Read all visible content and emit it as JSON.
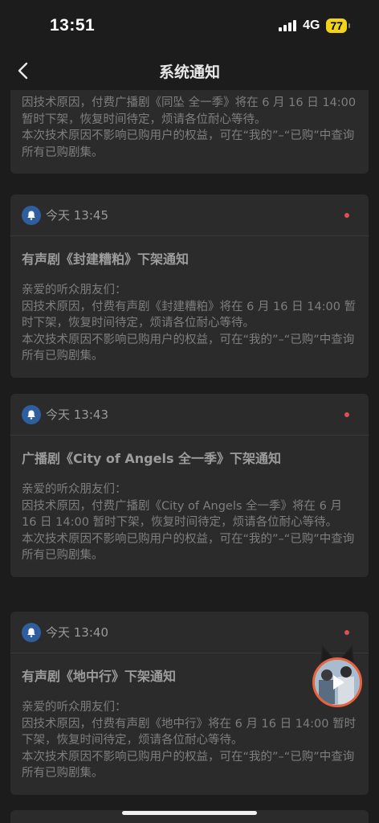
{
  "status": {
    "time": "13:51",
    "network": "4G",
    "battery": "77"
  },
  "nav": {
    "title": "系统通知"
  },
  "cards": [
    {
      "time": "",
      "title": "",
      "lines": [
        "因技术原因，付费广播剧《同坠 全一季》将在 6 月 16 日 14:00 暂时下架，恢复时间待定，烦请各位耐心等待。",
        "本次技术原因不影响已购用户的权益，可在“我的”–“已购”中查询所有已购剧集。"
      ]
    },
    {
      "time": "今天 13:45",
      "title": "有声剧《封建糟粕》下架通知",
      "lines": [
        "亲爱的听众朋友们：",
        "因技术原因，付费有声剧《封建糟粕》将在 6 月 16 日 14:00 暂时下架，恢复时间待定，烦请各位耐心等待。",
        "本次技术原因不影响已购用户的权益，可在“我的”–“已购”中查询所有已购剧集。"
      ]
    },
    {
      "time": "今天 13:43",
      "title": "广播剧《City of Angels 全一季》下架通知",
      "lines": [
        "亲爱的听众朋友们：",
        "因技术原因，付费广播剧《City of Angels 全一季》将在 6 月 16 日 14:00 暂时下架，恢复时间待定，烦请各位耐心等待。",
        "本次技术原因不影响已购用户的权益，可在“我的”–“已购”中查询所有已购剧集。"
      ]
    },
    {
      "time": "今天 13:40",
      "title": "有声剧《地中行》下架通知",
      "lines": [
        "亲爱的听众朋友们：",
        "因技术原因，付费有声剧《地中行》将在 6 月 16 日 14:00 暂时下架，恢复时间待定，烦请各位耐心等待。",
        "本次技术原因不影响已购用户的权益，可在“我的”–“已购”中查询所有已购剧集。"
      ]
    }
  ],
  "colors": {
    "accent_dot": "#e05050",
    "bell_bg": "#2f5e9e",
    "battery": "#f2d317"
  }
}
